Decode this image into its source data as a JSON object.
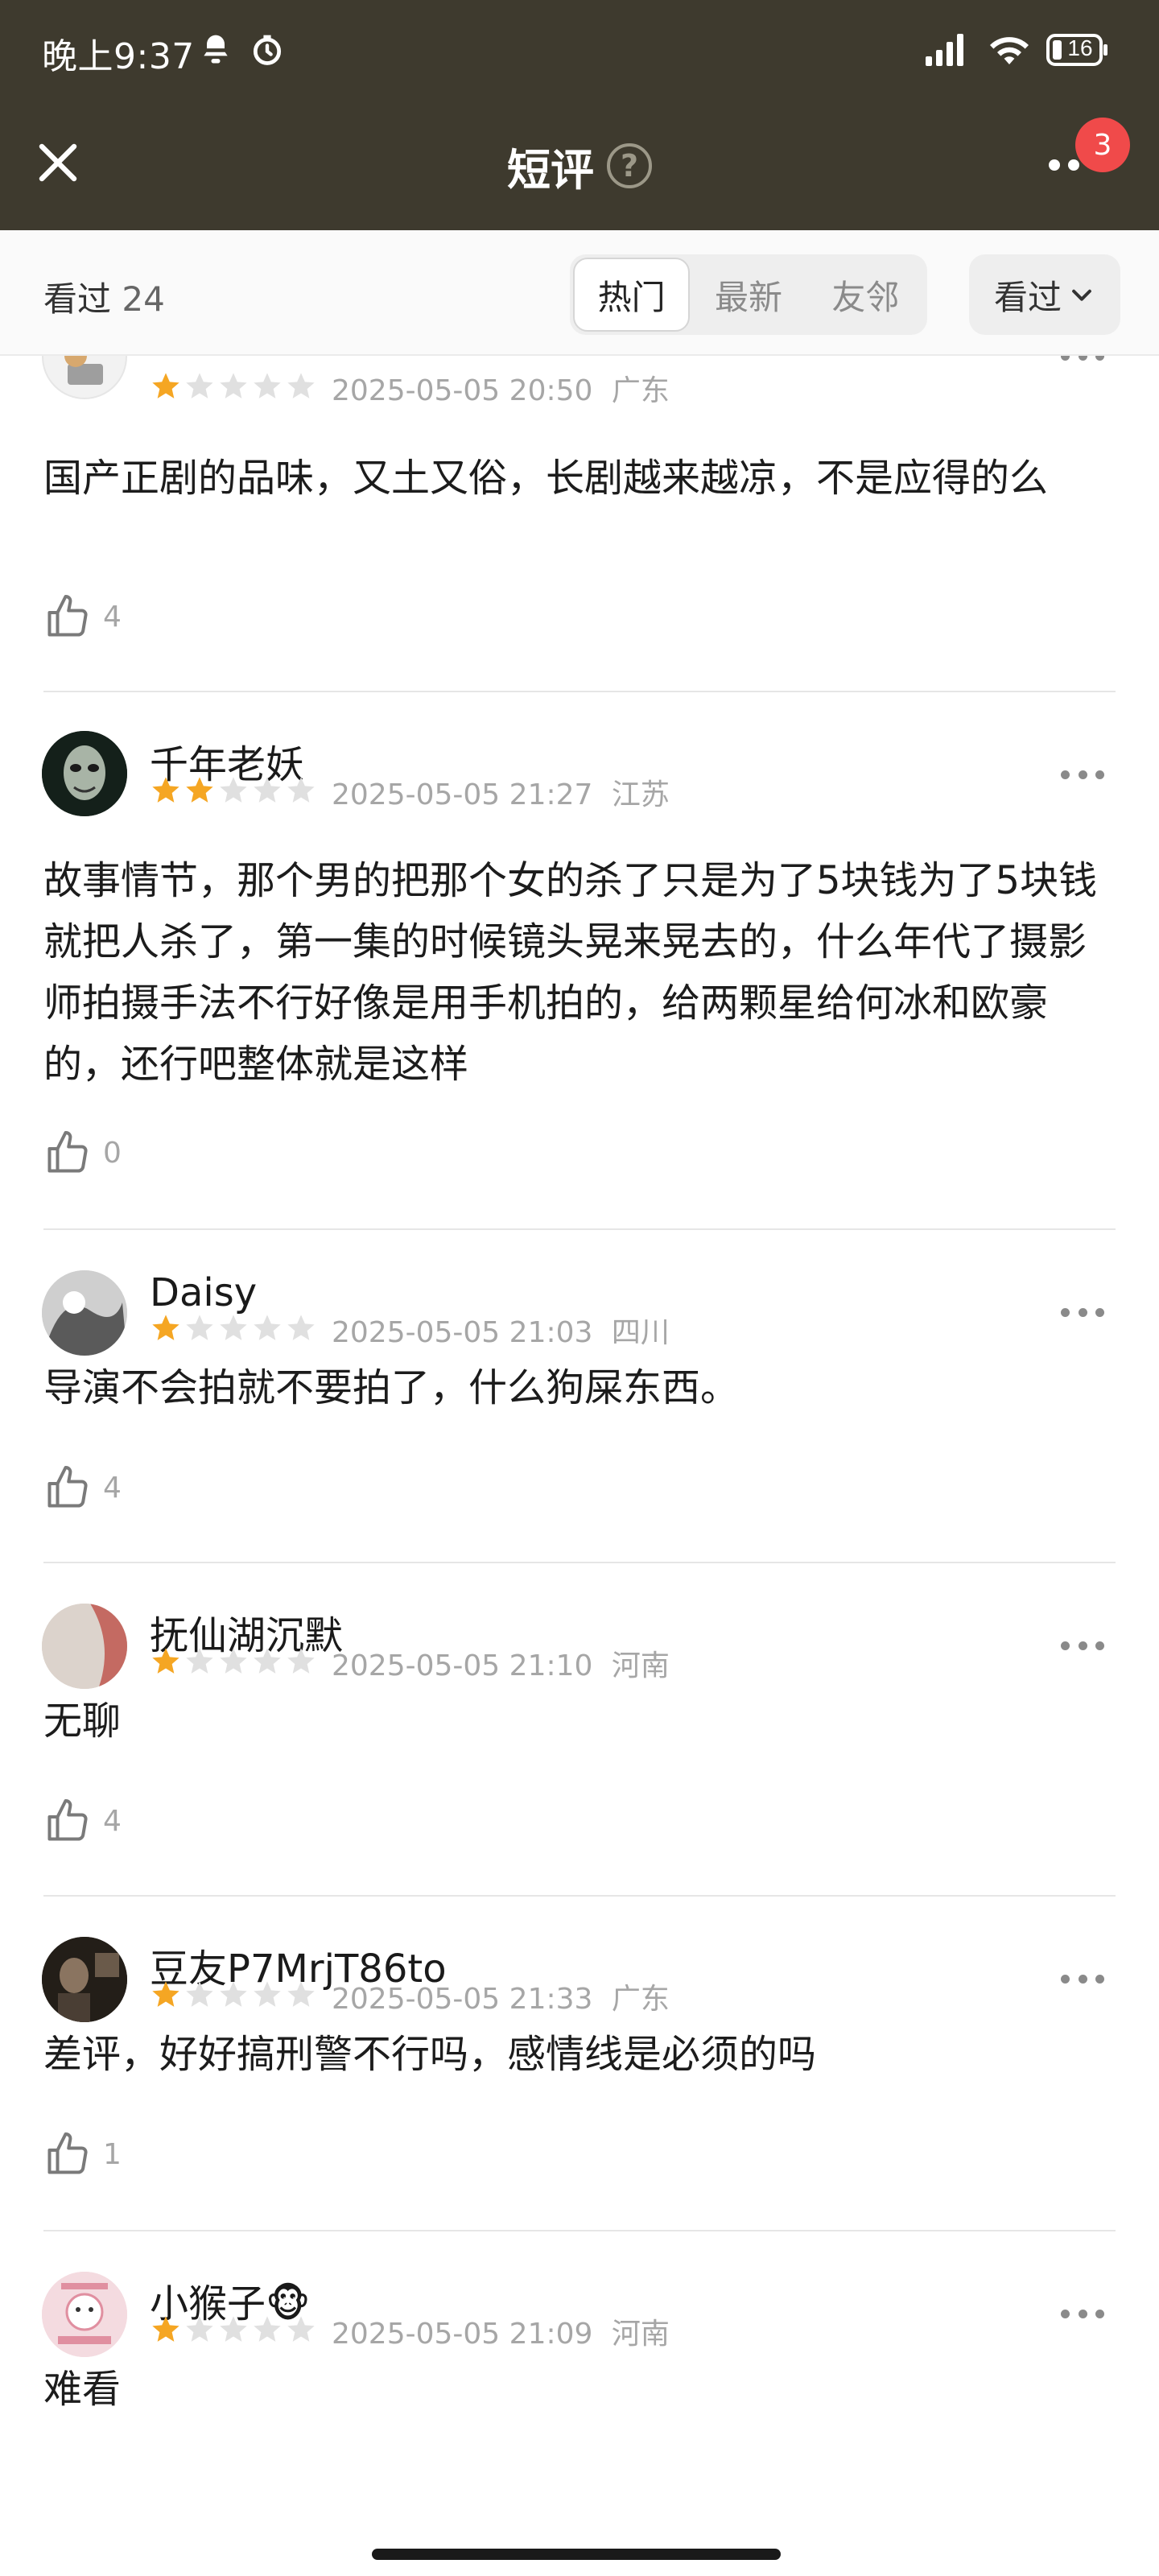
{
  "status_bar": {
    "time": "晚上9:37",
    "battery": "16",
    "icons": [
      "bell-icon",
      "clock-icon",
      "signal-icon",
      "wifi-icon",
      "battery-icon"
    ]
  },
  "header": {
    "title": "短评",
    "notification_badge": "3",
    "colors": {
      "background": "#3e3a2e",
      "badge": "#f04a4a"
    }
  },
  "filter_bar": {
    "watched_label": "看过",
    "watched_count": "24",
    "tabs": [
      {
        "label": "热门",
        "active": true
      },
      {
        "label": "最新",
        "active": false
      },
      {
        "label": "友邻",
        "active": false
      }
    ],
    "dropdown_label": "看过"
  },
  "comments": [
    {
      "username": "",
      "rating": 1,
      "date": "2025-05-05 20:50",
      "location": "广东",
      "content": "国产正剧的品味，又土又俗，长剧越来越凉，不是应得的么",
      "likes": "4"
    },
    {
      "username": "千年老妖",
      "rating": 2,
      "date": "2025-05-05 21:27",
      "location": "江苏",
      "content": "故事情节，那个男的把那个女的杀了只是为了5块钱为了5块钱就把人杀了，第一集的时候镜头晃来晃去的，什么年代了摄影师拍摄手法不行好像是用手机拍的，给两颗星给何冰和欧豪的，还行吧整体就是这样",
      "likes": "0"
    },
    {
      "username": "Daisy",
      "rating": 1,
      "date": "2025-05-05 21:03",
      "location": "四川",
      "content": "导演不会拍就不要拍了，什么狗屎东西。",
      "likes": "4"
    },
    {
      "username": "抚仙湖沉默",
      "rating": 1,
      "date": "2025-05-05 21:10",
      "location": "河南",
      "content": "无聊",
      "likes": "4"
    },
    {
      "username": "豆友P7MrjT86to",
      "rating": 1,
      "date": "2025-05-05 21:33",
      "location": "广东",
      "content": "差评，好好搞刑警不行吗，感情线是必须的吗",
      "likes": "1"
    },
    {
      "username": "小猴子🐵",
      "rating": 1,
      "date": "2025-05-05 21:09",
      "location": "河南",
      "content": "难看",
      "likes": ""
    }
  ],
  "colors": {
    "star_filled": "#f5a623",
    "star_empty": "#e0e0e0"
  }
}
